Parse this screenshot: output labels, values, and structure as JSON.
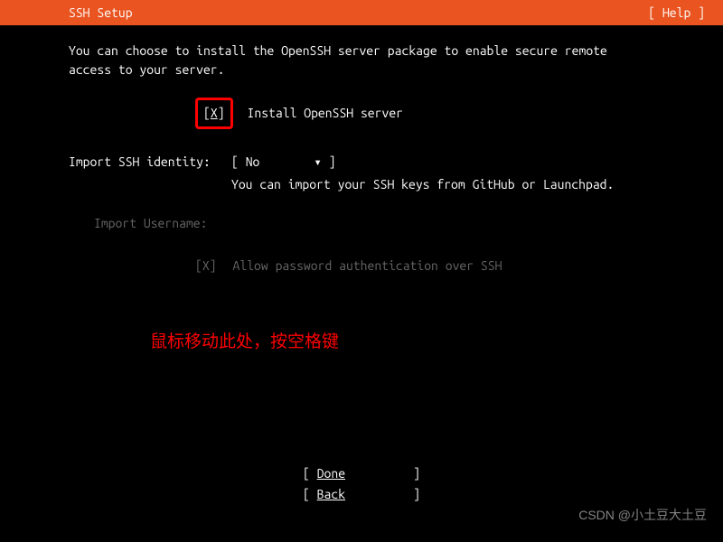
{
  "header": {
    "title": "SSH Setup",
    "help": "[ Help ]"
  },
  "description": "You can choose to install the OpenSSH server package to enable secure remote access to your server.",
  "install_openssh": {
    "checkbox_display": "X",
    "label": "Install OpenSSH server"
  },
  "import_identity": {
    "label": "Import SSH identity:",
    "value": "No",
    "hint": "You can import your SSH keys from GitHub or Launchpad."
  },
  "import_username": {
    "label": "Import Username:"
  },
  "allow_password": {
    "checkbox_display": "[X]",
    "label": "Allow password authentication over SSH"
  },
  "annotation": "鼠标移动此处，按空格键",
  "footer": {
    "done": "Done",
    "back": "Back"
  },
  "watermark": "CSDN @小土豆大土豆"
}
